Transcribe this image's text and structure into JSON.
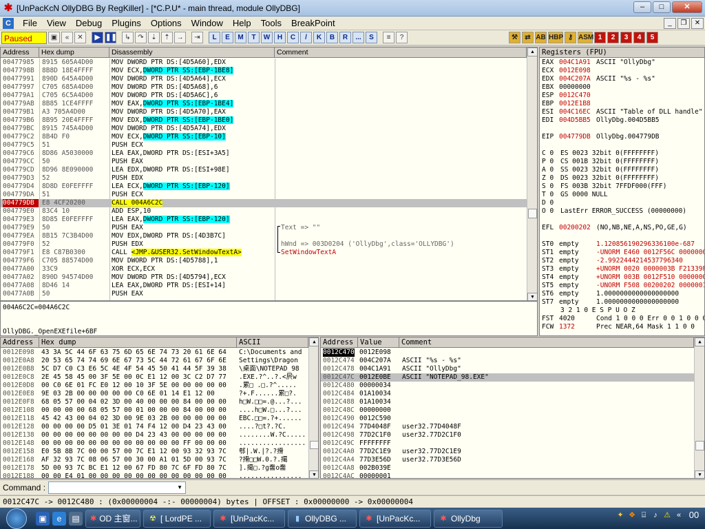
{
  "window": {
    "title": "[UnPacKcN OllyDBG By RegKiller] - [*C.P.U* - main thread, module OllyDBG]"
  },
  "menu": [
    "File",
    "View",
    "Debug",
    "Plugins",
    "Options",
    "Window",
    "Help",
    "Tools",
    "BreakPoint"
  ],
  "toolbar": {
    "status": "Paused",
    "letters": [
      "L",
      "E",
      "M",
      "T",
      "W",
      "H",
      "C",
      "/",
      "K",
      "B",
      "R",
      "...",
      "S"
    ],
    "right_labels": [
      "HBP",
      "ASM",
      "1",
      "2",
      "3",
      "4",
      "5"
    ]
  },
  "disasm": {
    "headers": {
      "addr": "Address",
      "hex": "Hex dump",
      "dis": "Disassembly",
      "comment": "Comment"
    },
    "rows": [
      {
        "a": "00477985",
        "h": "8915 605A4D00",
        "pre": "MOV DWORD PTR DS:[4D5A60],EDX",
        "hi": "",
        "post": "",
        "c": ""
      },
      {
        "a": "0047798B",
        "h": "8B8D 18E4FFFF",
        "pre": "MOV ECX,",
        "hi": "DWORD PTR SS:[EBP-1BE8]",
        "post": "",
        "c": ""
      },
      {
        "a": "00477991",
        "h": "890D 645A4D00",
        "pre": "MOV DWORD PTR DS:[4D5A64],ECX",
        "hi": "",
        "post": "",
        "c": ""
      },
      {
        "a": "00477997",
        "h": "C705 685A4D00",
        "pre": "MOV DWORD PTR DS:[4D5A68],6",
        "hi": "",
        "post": "",
        "c": ""
      },
      {
        "a": "004779A1",
        "h": "C705 6C5A4D00",
        "pre": "MOV DWORD PTR DS:[4D5A6C],6",
        "hi": "",
        "post": "",
        "c": ""
      },
      {
        "a": "004779AB",
        "h": "8B85 1CE4FFFF",
        "pre": "MOV EAX,",
        "hi": "DWORD PTR SS:[EBP-1BE4]",
        "post": "",
        "c": ""
      },
      {
        "a": "004779B1",
        "h": "A3 705A4D00",
        "pre": "MOV DWORD PTR DS:[4D5A70],EAX",
        "hi": "",
        "post": "",
        "c": ""
      },
      {
        "a": "004779B6",
        "h": "8B95 20E4FFFF",
        "pre": "MOV EDX,",
        "hi": "DWORD PTR SS:[EBP-1BE0]",
        "post": "",
        "c": ""
      },
      {
        "a": "004779BC",
        "h": "8915 745A4D00",
        "pre": "MOV DWORD PTR DS:[4D5A74],EDX",
        "hi": "",
        "post": "",
        "c": ""
      },
      {
        "a": "004779C2",
        "h": "8B4D F0",
        "pre": "MOV ECX,",
        "hi": "DWORD PTR SS:[EBP-10]",
        "post": "",
        "c": ""
      },
      {
        "a": "004779C5",
        "h": "51",
        "pre": "PUSH ECX",
        "hi": "",
        "post": "",
        "c": ""
      },
      {
        "a": "004779C6",
        "h": "8D86 A5030000",
        "pre": "LEA EAX,DWORD PTR DS:[ESI+3A5]",
        "hi": "",
        "post": "",
        "c": ""
      },
      {
        "a": "004779CC",
        "h": "50",
        "pre": "PUSH EAX",
        "hi": "",
        "post": "",
        "c": ""
      },
      {
        "a": "004779CD",
        "h": "8D96 8E090000",
        "pre": "LEA EDX,DWORD PTR DS:[ESI+98E]",
        "hi": "",
        "post": "",
        "c": ""
      },
      {
        "a": "004779D3",
        "h": "52",
        "pre": "PUSH EDX",
        "hi": "",
        "post": "",
        "c": ""
      },
      {
        "a": "004779D4",
        "h": "8D8D E0FEFFFF",
        "pre": "LEA ECX,",
        "hi": "DWORD PTR SS:[EBP-120]",
        "post": "",
        "c": ""
      },
      {
        "a": "004779DA",
        "h": "51",
        "pre": "PUSH ECX",
        "hi": "",
        "post": "",
        "c": ""
      },
      {
        "a": "004779DB",
        "h": "E8 4CF20200",
        "pre": "",
        "hi": "CALL 004A6C2C",
        "post": "",
        "c": "",
        "selected": true,
        "yellowcall": true
      },
      {
        "a": "004779E0",
        "h": "83C4 10",
        "pre": "ADD ESP,10",
        "hi": "",
        "post": "",
        "c": ""
      },
      {
        "a": "004779E3",
        "h": "8D85 E0FEFFFF",
        "pre": "LEA EAX,",
        "hi": "DWORD PTR SS:[EBP-120]",
        "post": "",
        "c": ""
      },
      {
        "a": "004779E9",
        "h": "50",
        "pre": "PUSH EAX",
        "hi": "",
        "post": "",
        "c": "Text => \"\""
      },
      {
        "a": "004779EA",
        "h": "8B15 7C3B4D00",
        "pre": "MOV EDX,DWORD PTR DS:[4D3B7C]",
        "hi": "",
        "post": "",
        "c": ""
      },
      {
        "a": "004779F0",
        "h": "52",
        "pre": "PUSH EDX",
        "hi": "",
        "post": "",
        "c": "hWnd => 003D0204 ('OllyDbg',class='OLLYDBG')"
      },
      {
        "a": "004779F1",
        "h": "E8 C87B0300",
        "pre": "CALL ",
        "hi": "<JMP.&USER32.SetWindowTextA>",
        "post": "",
        "c": "SetWindowTextA",
        "callcomment": true
      },
      {
        "a": "004779F6",
        "h": "C705 88574D00",
        "pre": "MOV DWORD PTR DS:[4D5788],1",
        "hi": "",
        "post": "",
        "c": ""
      },
      {
        "a": "00477A00",
        "h": "33C9",
        "pre": "XOR ECX,ECX",
        "hi": "",
        "post": "",
        "c": ""
      },
      {
        "a": "00477A02",
        "h": "890D 94574D00",
        "pre": "MOV DWORD PTR DS:[4D5794],ECX",
        "hi": "",
        "post": "",
        "c": ""
      },
      {
        "a": "00477A08",
        "h": "8D46 14",
        "pre": "LEA EAX,DWORD PTR DS:[ESI+14]",
        "hi": "",
        "post": "",
        "c": ""
      },
      {
        "a": "00477A0B",
        "h": "50",
        "pre": "PUSH EAX",
        "hi": "",
        "post": "",
        "c": ""
      }
    ],
    "info1": "004A6C2C=004A6C2C",
    "info2": "OllyDBG._OpenEXEfile+6BF"
  },
  "registers": {
    "title": "Registers (FPU)",
    "rows": [
      {
        "n": "EAX",
        "v": "004C1A91",
        "d": "ASCII \"OllyDbg\""
      },
      {
        "n": "ECX",
        "v": "0012E098",
        "d": ""
      },
      {
        "n": "EDX",
        "v": "004C207A",
        "d": "ASCII \"%s - %s\""
      },
      {
        "n": "EBX",
        "v": "00000000",
        "d": ""
      },
      {
        "n": "ESP",
        "v": "0012C470",
        "d": ""
      },
      {
        "n": "EBP",
        "v": "0012E1B8",
        "d": ""
      },
      {
        "n": "ESI",
        "v": "004C16EC",
        "d": "ASCII \"Table of DLL handle\""
      },
      {
        "n": "EDI",
        "v": "004D5BB5",
        "d": "OllyDbg.004D5BB5"
      },
      {
        "n": "",
        "v": "",
        "d": ""
      },
      {
        "n": "EIP",
        "v": "004779DB",
        "d": "OllyDbg.004779DB"
      },
      {
        "n": "",
        "v": "",
        "d": ""
      },
      {
        "n": "C 0",
        "v": "",
        "d": "ES 0023 32bit 0(FFFFFFFF)"
      },
      {
        "n": "P 0",
        "v": "",
        "d": "CS 001B 32bit 0(FFFFFFFF)"
      },
      {
        "n": "A 0",
        "v": "",
        "d": "SS 0023 32bit 0(FFFFFFFF)"
      },
      {
        "n": "Z 0",
        "v": "",
        "d": "DS 0023 32bit 0(FFFFFFFF)"
      },
      {
        "n": "S 0",
        "v": "",
        "d": "FS 003B 32bit 7FFDF000(FFF)"
      },
      {
        "n": "T 0",
        "v": "",
        "d": "GS 0000 NULL"
      },
      {
        "n": "D 0",
        "v": "",
        "d": ""
      },
      {
        "n": "O 0",
        "v": "",
        "d": "LastErr ERROR_SUCCESS (00000000)"
      },
      {
        "n": "",
        "v": "",
        "d": ""
      },
      {
        "n": "EFL",
        "v": "00200202",
        "d": "(NO,NB,NE,A,NS,PO,GE,G)"
      },
      {
        "n": "",
        "v": "",
        "d": ""
      },
      {
        "n": "ST0",
        "v": "empty",
        "d": "1.120856190296336100e-687"
      },
      {
        "n": "ST1",
        "v": "empty",
        "d": "-UNORM E460 0012F56C 00000000"
      },
      {
        "n": "ST2",
        "v": "empty",
        "d": "-2.9922444214537796340"
      },
      {
        "n": "ST3",
        "v": "empty",
        "d": "+UNORM 0020 0000003B F21339F0"
      },
      {
        "n": "ST4",
        "v": "empty",
        "d": "+UNORM 003B 0012F510 00000000"
      },
      {
        "n": "ST5",
        "v": "empty",
        "d": "-UNORM F508 00200202 0000001B"
      },
      {
        "n": "ST6",
        "v": "empty",
        "d": "1.0000000000000000000"
      },
      {
        "n": "ST7",
        "v": "empty",
        "d": "1.0000000000000000000"
      },
      {
        "n": "",
        "v": "",
        "d": "3 2 1 0      E S P U O Z"
      },
      {
        "n": "FST",
        "v": "4020",
        "d": "Cond 1 0 0 0  Err 0 0 1 0 0 0"
      },
      {
        "n": "FCW",
        "v": "1372",
        "d": "Prec NEAR,64  Mask    1 1 0 0"
      }
    ]
  },
  "dump": {
    "headers": {
      "addr": "Address",
      "hex": "Hex dump",
      "ascii": "ASCII"
    },
    "rows": [
      {
        "a": "0012E098",
        "h": "43 3A 5C 44 6F 63 75 6D 65 6E 74 73 20 61 6E 64",
        "s": "C:\\Documents and"
      },
      {
        "a": "0012E0A8",
        "h": "20 53 65 74 74 69 6E 67 73 5C 44 72 61 67 6F 6E",
        "s": " Settings\\Dragon"
      },
      {
        "a": "0012E0B8",
        "h": "5C D7 C0 C3 E6 5C 4E 4F 54 45 50 41 44 5F 39 38",
        "s": "\\桌面\\NOTEPAD_98"
      },
      {
        "a": "0012E0C8",
        "h": "2E 45 58 45 00 3F 5E 00 0C E1 12 00 3C C2 D7 77",
        "s": ".EXE.?^..?.<屄w"
      },
      {
        "a": "0012E0D8",
        "h": "00 C0 6E 01 FC E0 12 00 10 3F 5E 00 00 00 00 00",
        "s": ".累□ .□.?^....."
      },
      {
        "a": "0012E0E8",
        "h": "9E 03 2B 00 00 00 00 00 C0 6E 01 14 E1 12 00",
        "s": "?+.F......累□?."
      },
      {
        "a": "0012E0F8",
        "h": "68 05 57 00 04 02 3D 00 40 00 00 00 84 00 00 00",
        "s": "h□W.□□=.@...?..."
      },
      {
        "a": "0012E108",
        "h": "00 00 00 00 68 05 57 00 01 00 00 00 84 00 00 00",
        "s": "....h□W.□...?..."
      },
      {
        "a": "0012E118",
        "h": "45 42 43 00 04 02 3D 00 9E 03 2B 00 00 00 00 00",
        "s": "EBC.□□=.?+......"
      },
      {
        "a": "0012E128",
        "h": "00 00 00 00 D5 01 3E 01 74 F4 12 00 D4 23 43 00",
        "s": "....?□t?.?C."
      },
      {
        "a": "0012E138",
        "h": "00 00 00 00 00 00 00 00 D4 23 43 00 00 00 00 00",
        "s": "........W.?C....."
      },
      {
        "a": "0012E148",
        "h": "00 00 00 00 00 00 00 00 00 00 00 00 FF 00 00 00",
        "s": "................."
      },
      {
        "a": "0012E158",
        "h": "E0 5B 8B 7C 00 00 57 00 7C E1 12 00 93 32 93 7C",
        "s": "郀|.W.|?.?搰"
      },
      {
        "a": "0012E168",
        "h": "AF 32 93 7C 08 06 57 00 30 00 A1 01 5D 00 93 7C",
        "s": "?搰□□W.0.?.擖"
      },
      {
        "a": "0012E178",
        "h": "5D 00 93 7C BC E1 12 00 67 FD 80 7C 6F FD 80 7C",
        "s": "].擖□.?g齹o齹"
      },
      {
        "a": "0012E188",
        "h": "00 00 E4 01 00 00 00 00 00 00 00 00 00 00 00 00",
        "s": "................"
      }
    ]
  },
  "stack": {
    "headers": {
      "addr": "Address",
      "val": "Value",
      "comment": "Comment"
    },
    "rows": [
      {
        "a": "0012C470",
        "v": "0012E098",
        "c": "",
        "top": true
      },
      {
        "a": "0012C474",
        "v": "004C207A",
        "c": "ASCII \"%s - %s\""
      },
      {
        "a": "0012C478",
        "v": "004C1A91",
        "c": "ASCII \"OllyDbg\""
      },
      {
        "a": "0012C47C",
        "v": "0012E0BE",
        "c": "ASCII \"NOTEPAD_98.EXE\"",
        "sel": true
      },
      {
        "a": "0012C480",
        "v": "00000034",
        "c": ""
      },
      {
        "a": "0012C484",
        "v": "01A10034",
        "c": ""
      },
      {
        "a": "0012C488",
        "v": "01A10034",
        "c": ""
      },
      {
        "a": "0012C48C",
        "v": "00000000",
        "c": ""
      },
      {
        "a": "0012C490",
        "v": "0012C590",
        "c": ""
      },
      {
        "a": "0012C494",
        "v": "77D4048F",
        "c": "user32.77D4048F"
      },
      {
        "a": "0012C498",
        "v": "77D2C1F0",
        "c": "user32.77D2C1F0"
      },
      {
        "a": "0012C49C",
        "v": "FFFFFFFF",
        "c": ""
      },
      {
        "a": "0012C4A0",
        "v": "77D2C1E9",
        "c": "user32.77D2C1E9"
      },
      {
        "a": "0012C4A4",
        "v": "77D3E56D",
        "c": "user32.77D3E56D"
      },
      {
        "a": "0012C4A8",
        "v": "002B039E",
        "c": ""
      },
      {
        "a": "0012C4AC",
        "v": "00000001",
        "c": ""
      }
    ]
  },
  "command": {
    "label": "Command :",
    "value": ""
  },
  "statusbar": "0012C47C -> 0012C480 : (0x00000004  -:-  00000004) bytes  |  OFFSET : 0x00000000 -> 0x00000004",
  "taskbar": {
    "tasks": [
      "OD 主窗...",
      "[ LordPE ...",
      "[UnPacKc...",
      "OllyDBG ...",
      "[UnPacKc...",
      "OllyDbg"
    ],
    "clock": "00"
  },
  "colors": {
    "paused_bg": "#ffff00",
    "paused_fg": "#c00000",
    "highlight": "#00ffff",
    "call_yellow": "#ffff00",
    "reg_changed": "#c00000"
  }
}
